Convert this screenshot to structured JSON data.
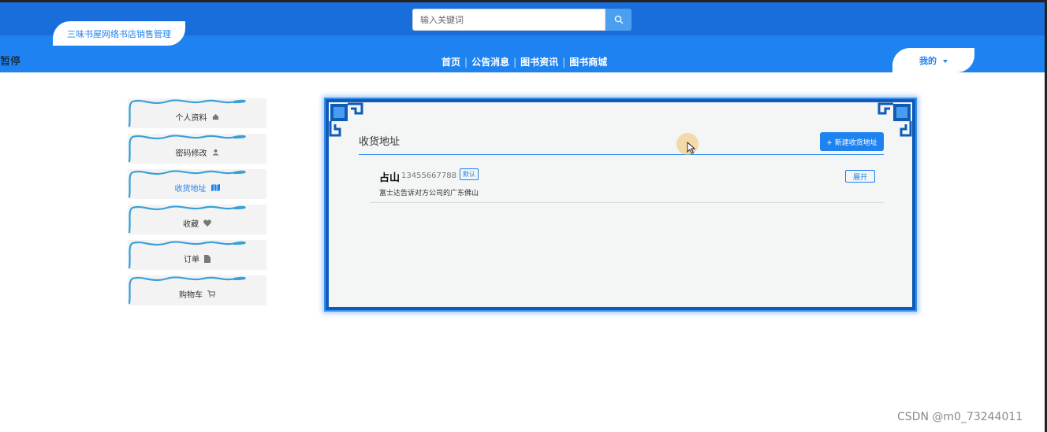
{
  "header": {
    "brand": "三味书屋网络书店销售管理",
    "search_placeholder": "输入关键词",
    "paused_label": "暂停",
    "nav": [
      "首页",
      "公告消息",
      "图书资讯",
      "图书商城"
    ],
    "mine_label": "我的"
  },
  "sidebar": {
    "items": [
      {
        "label": "个人资料",
        "icon": "home-icon"
      },
      {
        "label": "密码修改",
        "icon": "user-icon"
      },
      {
        "label": "收货地址",
        "icon": "map-icon",
        "active": true
      },
      {
        "label": "收藏",
        "icon": "heart-icon"
      },
      {
        "label": "订单",
        "icon": "file-icon"
      },
      {
        "label": "购物车",
        "icon": "cart-icon"
      }
    ]
  },
  "main": {
    "title": "收货地址",
    "new_button": "+ 新建收货地址",
    "addresses": [
      {
        "name": "占山",
        "phone": "13455667788",
        "default_tag": "默认",
        "address": "富士达告诉对方公司的广东佛山",
        "expand_label": "展开"
      }
    ]
  },
  "watermark": "CSDN @m0_73244011",
  "colors": {
    "primary": "#1e82f0",
    "header_dark": "#1a6edb",
    "panel_border": "#0f5cb8"
  }
}
